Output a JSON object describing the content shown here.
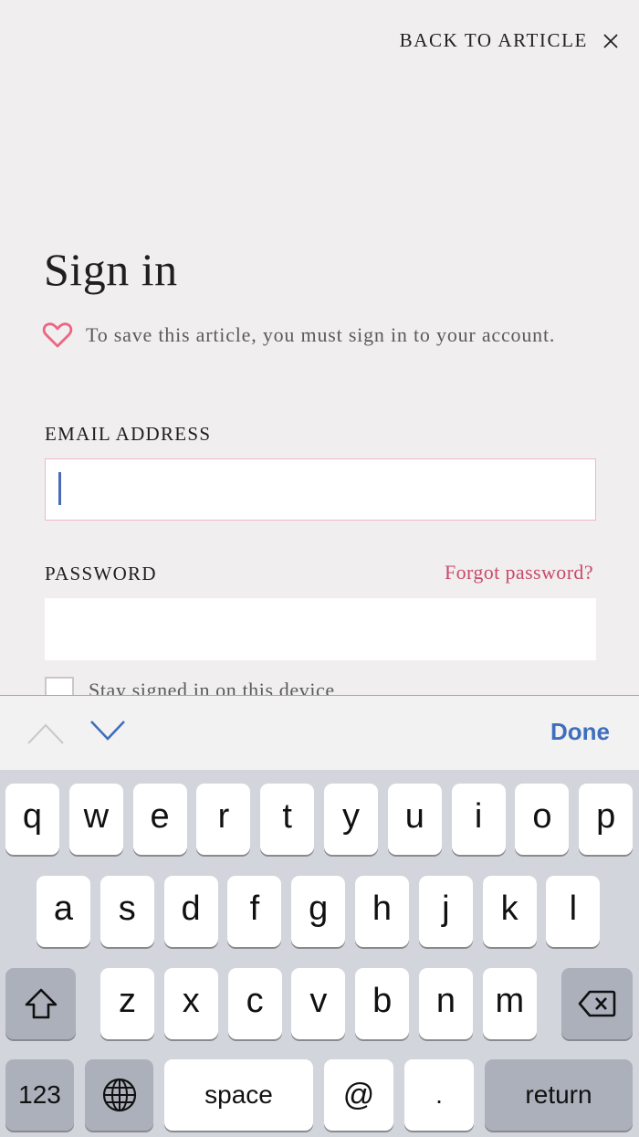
{
  "header": {
    "back_label": "BACK TO ARTICLE",
    "close_icon": "close-icon"
  },
  "signin": {
    "title": "Sign in",
    "notice_icon": "heart-icon",
    "notice_text": "To save this article, you must sign in to your account.",
    "email": {
      "label": "EMAIL ADDRESS",
      "value": "",
      "focused": true
    },
    "password": {
      "label": "PASSWORD",
      "value": "",
      "forgot_label": "Forgot password?"
    },
    "stay_signed_in": {
      "label": "Stay signed in on this device",
      "checked": false
    }
  },
  "accessory_bar": {
    "prev_icon": "chevron-up-icon",
    "next_icon": "chevron-down-icon",
    "done_label": "Done"
  },
  "keyboard": {
    "row1": [
      "q",
      "w",
      "e",
      "r",
      "t",
      "y",
      "u",
      "i",
      "o",
      "p"
    ],
    "row2": [
      "a",
      "s",
      "d",
      "f",
      "g",
      "h",
      "j",
      "k",
      "l"
    ],
    "row3": [
      "z",
      "x",
      "c",
      "v",
      "b",
      "n",
      "m"
    ],
    "shift_icon": "shift-icon",
    "backspace_icon": "backspace-icon",
    "numbers_label": "123",
    "globe_icon": "globe-icon",
    "space_label": "space",
    "at_label": "@",
    "period_label": ".",
    "return_label": "return"
  },
  "colors": {
    "accent_pink": "#c94a6a",
    "heart_pink": "#ec6682",
    "ios_blue": "#3f6fbc",
    "page_bg": "#f0eeef",
    "keyboard_bg": "#d2d5db"
  }
}
